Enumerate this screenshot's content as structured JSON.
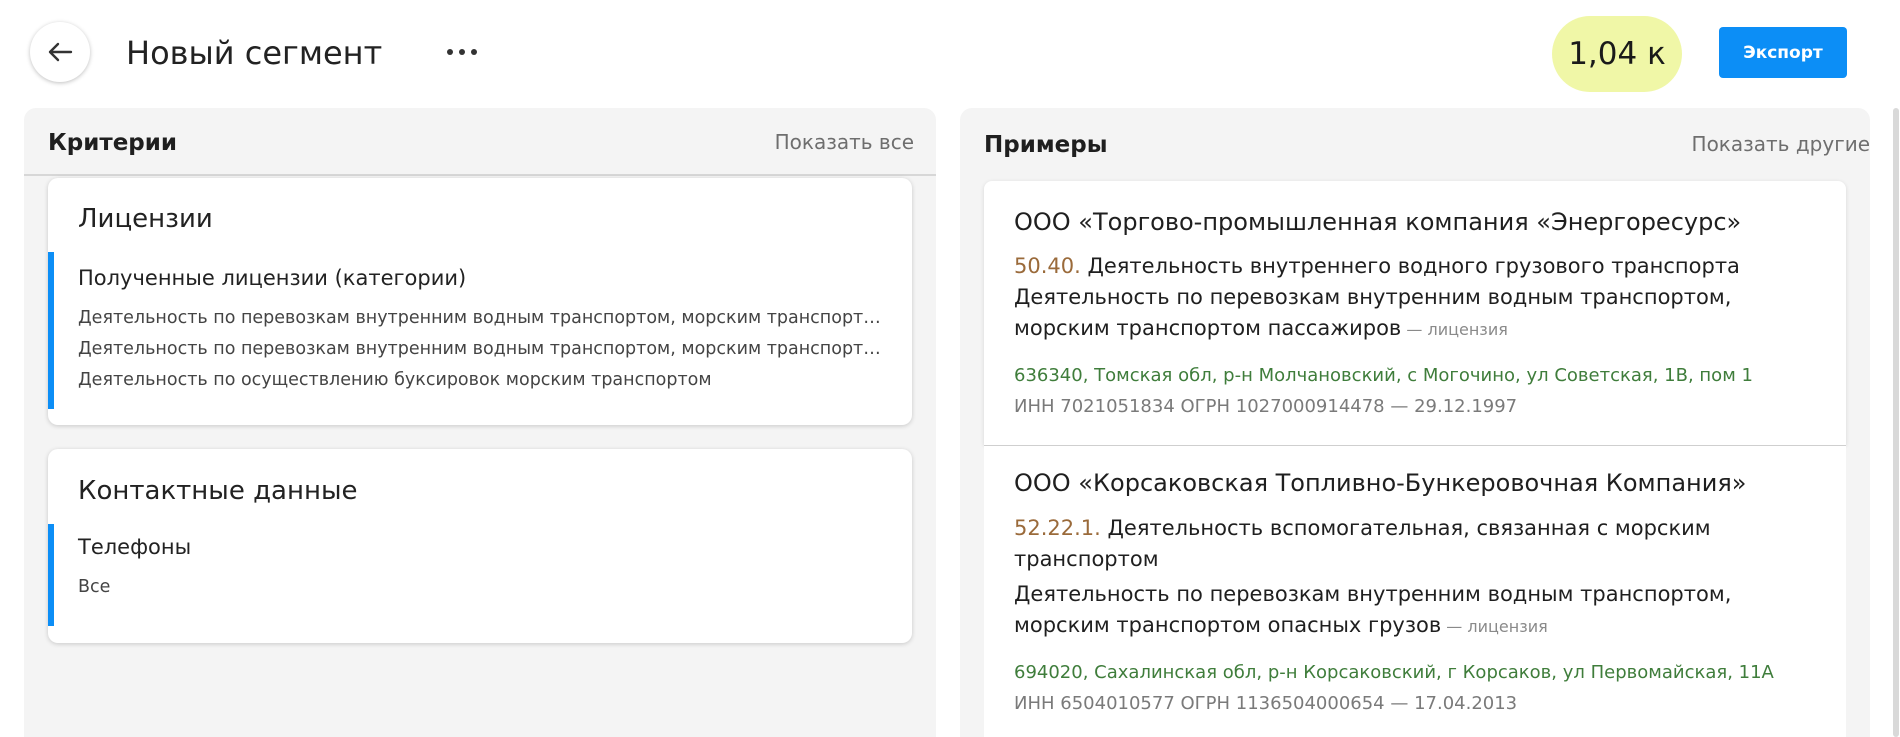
{
  "header": {
    "title": "Новый сегмент",
    "count": "1,04 к",
    "export_label": "Экспорт"
  },
  "criteria": {
    "title": "Критерии",
    "show_all": "Показать все",
    "licenses": {
      "title": "Лицензии",
      "name": "Полученные лицензии (категории)",
      "lines": [
        "Деятельность по перевозкам внутренним водным транспортом, морским транспортом пассажиров",
        "Деятельность по перевозкам внутренним водным транспортом, морским транспортом опасных грузов",
        "Деятельность по осуществлению буксировок морским транспортом"
      ]
    },
    "contacts": {
      "title": "Контактные данные",
      "name": "Телефоны",
      "value": "Все"
    }
  },
  "examples": {
    "title": "Примеры",
    "show_other": "Показать другие",
    "items": [
      {
        "name": "ООО «Торгово-промышленная компания «Энергоресурс»",
        "okved_code": "50.40.",
        "okved_text": " Деятельность внутреннего водного грузового транспорта",
        "license_line1": "Деятельность по перевозкам внутренним водным транспортом,",
        "license_line2": "морским транспортом пассажиров",
        "license_tag": " — лицензия",
        "address": "636340, Томская обл, р-н Молчановский, с Могочино, ул Советская, 1В, пом 1",
        "registration": "ИНН 7021051834 ОГРН 1027000914478 — 29.12.1997"
      },
      {
        "name": "ООО «Корсаковская Топливно-Бункеровочная Компания»",
        "okved_code": "52.22.1.",
        "okved_text": " Деятельность вспомогательная, связанная с морским",
        "okved_text2": "транспортом",
        "license_line1": "Деятельность по перевозкам внутренним водным транспортом,",
        "license_line2": "морским транспортом опасных грузов",
        "license_tag": " — лицензия",
        "address": "694020, Сахалинская обл, р-н Корсаковский, г Корсаков, ул Первомайская, 11А",
        "registration": "ИНН 6504010577 ОГРН 1136504000654 — 17.04.2013"
      }
    ]
  },
  "colors": {
    "accent": "#0c8ef6",
    "count_highlight": "#f0f7a7",
    "okved_code": "#9a6a3a",
    "address": "#3f7d3b"
  }
}
